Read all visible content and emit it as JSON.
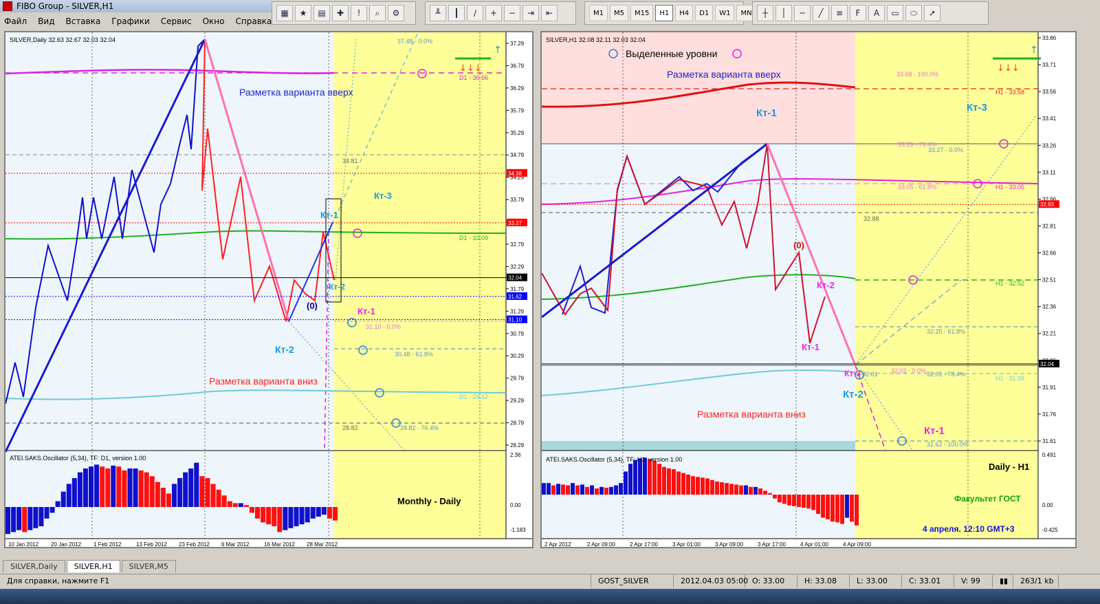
{
  "window": {
    "title": "FIBO Group - SILVER,H1"
  },
  "menu": [
    "Файл",
    "Вид",
    "Вставка",
    "Графики",
    "Сервис",
    "Окно",
    "Справка"
  ],
  "timeframes": [
    "M1",
    "M5",
    "M15",
    "H1",
    "H4",
    "D1",
    "W1",
    "MN"
  ],
  "selected_timeframe": "H1",
  "tabs": [
    "SILVER,Daily",
    "SILVER,H1",
    "SILVER,M5"
  ],
  "active_tab": "SILVER,H1",
  "status": {
    "help": "Для справки, нажмите F1",
    "profile": "GOST_SILVER",
    "datetime": "2012.04.03 05:00",
    "open": "O: 33.00",
    "high": "H: 33.08",
    "low": "L: 33.00",
    "close": "C: 33.01",
    "volume": "V: 99",
    "traffic": "263/1 kb"
  },
  "colors": {
    "bg_light_blue": "#eef6fb",
    "bg_yellow": "#ffff99",
    "bg_pink": "#ffdede",
    "bull": "#1010cc",
    "bear": "#ff1010"
  },
  "left_chart": {
    "header": "SILVER,Daily  32.63 32.67 32.03 32.04",
    "osc_header": "ATEI.SAKS.Oscillator (5,34), TF: D1, version 1.00",
    "osc_label": "Monthly - Daily",
    "price_min": 28.29,
    "price_max": 37.29,
    "price_ticks": [
      "37.29",
      "36.79",
      "36.29",
      "35.79",
      "35.29",
      "34.79",
      "34.29",
      "33.79",
      "33.29",
      "32.79",
      "32.29",
      "31.79",
      "31.29",
      "30.79",
      "30.29",
      "29.79",
      "29.29",
      "28.79",
      "28.29"
    ],
    "osc_ticks": [
      "2.36",
      "0.00",
      "-1.183"
    ],
    "date_ticks": [
      "10 Jan 2012",
      "20 Jan 2012",
      "1 Feb 2012",
      "13 Feb 2012",
      "23 Feb 2012",
      "6 Mar 2012",
      "16 Mar 2012",
      "28 Mar 2012"
    ],
    "price_tags": [
      {
        "text": "34.38",
        "value": 34.38,
        "color": "#ff0000"
      },
      {
        "text": "33.27",
        "value": 33.27,
        "color": "#ff0000"
      },
      {
        "text": "32.04",
        "value": 32.04,
        "color": "#000000"
      },
      {
        "text": "31.62",
        "value": 31.62,
        "color": "#0000ff"
      },
      {
        "text": "31.10",
        "value": 31.1,
        "color": "#0000ff"
      }
    ],
    "labels": {
      "up": "Разметка варианта вверх",
      "down": "Разметка варианта вниз",
      "kt1_blue": "Кт-1",
      "kt2_blue": "Кт-2",
      "kt3_blue": "Кт-3",
      "kt2_top": "Кт-2",
      "kt1_mag": "Кт-1",
      "zero": "(0)",
      "lvl_3748": "37.48 - 0.0%",
      "lvl_d1_3666": "D1 - 36.66",
      "lvl_3481": "34.81",
      "lvl_d1_3309": "D1 - 33.09",
      "lvl_3110": "31.10 - 0.0%",
      "lvl_3048": "30.48 - 61.8%",
      "lvl_d1_2952": "D1 - 29.52",
      "lvl_2882a": "28.82",
      "lvl_2882b": "28.82 - 76.4%"
    },
    "osc_values": [
      -1.4,
      -1.3,
      -1.2,
      -1.3,
      -1.2,
      -1.1,
      -1.0,
      -0.6,
      -0.3,
      0.3,
      0.8,
      1.2,
      1.5,
      1.8,
      2.0,
      2.1,
      2.2,
      2.1,
      2.0,
      2.15,
      2.1,
      1.9,
      2.0,
      2.0,
      1.9,
      1.8,
      1.6,
      1.3,
      1.0,
      0.7,
      1.2,
      1.5,
      1.8,
      2.0,
      2.3,
      1.6,
      1.5,
      1.2,
      0.9,
      0.6,
      0.3,
      0.2,
      0.2,
      0.1,
      -0.3,
      -0.6,
      -0.8,
      -0.9,
      -1.0,
      -1.3,
      -1.2,
      -1.1,
      -1.0,
      -0.9,
      -0.8,
      -0.6,
      -0.5,
      -0.4,
      -0.6,
      -0.7
    ]
  },
  "right_chart": {
    "header": "SILVER,H1  32.08 32.11 32.03 32.04",
    "legend": "Выделенные уровни",
    "osc_header": "ATEI.SAKS.Oscillator (5,34), TF: H1, version 1.00",
    "osc_label_1": "Daily - H1",
    "osc_label_2": "Факультет ГОСТ",
    "osc_label_3": "4 апреля. 12:10 GMT+3",
    "price_min": 31.61,
    "price_max": 33.86,
    "price_ticks": [
      "33.86",
      "33.71",
      "33.56",
      "33.41",
      "33.26",
      "33.11",
      "32.96",
      "32.81",
      "32.66",
      "32.51",
      "32.36",
      "32.21",
      "32.06",
      "31.91",
      "31.76",
      "31.61"
    ],
    "osc_ticks": [
      "0.491",
      "0.00",
      "-0.425"
    ],
    "date_ticks": [
      "2 Apr 2012",
      "2 Apr 09:00",
      "2 Apr 17:00",
      "3 Apr 01:00",
      "3 Apr 09:00",
      "3 Apr 17:00",
      "4 Apr 01:00",
      "4 Apr 09:00"
    ],
    "price_tags": [
      {
        "text": "32.93",
        "value": 32.93,
        "color": "#ff0000"
      },
      {
        "text": "32.04",
        "value": 32.04,
        "color": "#000000"
      }
    ],
    "labels": {
      "up": "Разметка варианта вверх",
      "down": "Разметка варианта вниз",
      "kt1_top": "Кт-1",
      "kt3": "Кт-3",
      "kt2_mag": "Кт-2",
      "kt1_mag": "Кт-1",
      "kt3_mag": "Кт-3",
      "kt2_blue": "Кт-2",
      "kt1_bottom": "Кт-1",
      "zero": "(0)",
      "lvl_3368": "33.68 - 100.0%",
      "lvl_h1_3358": "H1 - 33.58",
      "lvl_3327": "33.27 - 0.0%",
      "lvl_3329": "33.29 - 76.4%",
      "lvl_3305": "33.05 - 61.8%",
      "lvl_h1_3305": "H1 - 33.05",
      "lvl_3288": "32.88",
      "lvl_h1_3252": "H1 - 32.52",
      "lvl_3225": "32.25 - 61.8%",
      "lvl_3201": "32.01",
      "lvl_3203": "32.03 - 0.0%",
      "lvl_3201b": "32.01 - 76.4%",
      "lvl_h1_3199": "H1 - 31.99",
      "lvl_3162": "31.62 - 100.0%"
    },
    "osc_values": [
      0.15,
      0.15,
      0.12,
      0.14,
      0.13,
      0.12,
      0.15,
      0.12,
      0.13,
      0.1,
      0.12,
      0.08,
      0.1,
      0.09,
      0.1,
      0.12,
      0.15,
      0.3,
      0.4,
      0.45,
      0.47,
      0.48,
      0.46,
      0.44,
      0.4,
      0.36,
      0.34,
      0.33,
      0.3,
      0.28,
      0.26,
      0.24,
      0.23,
      0.22,
      0.21,
      0.19,
      0.17,
      0.16,
      0.15,
      0.14,
      0.13,
      0.12,
      0.12,
      0.1,
      0.1,
      0.08,
      0.05,
      0.02,
      -0.05,
      -0.1,
      -0.12,
      -0.14,
      -0.15,
      -0.16,
      -0.17,
      -0.18,
      -0.2,
      -0.25,
      -0.3,
      -0.32,
      -0.35,
      -0.36,
      -0.38,
      -0.3,
      -0.35,
      -0.4
    ]
  }
}
